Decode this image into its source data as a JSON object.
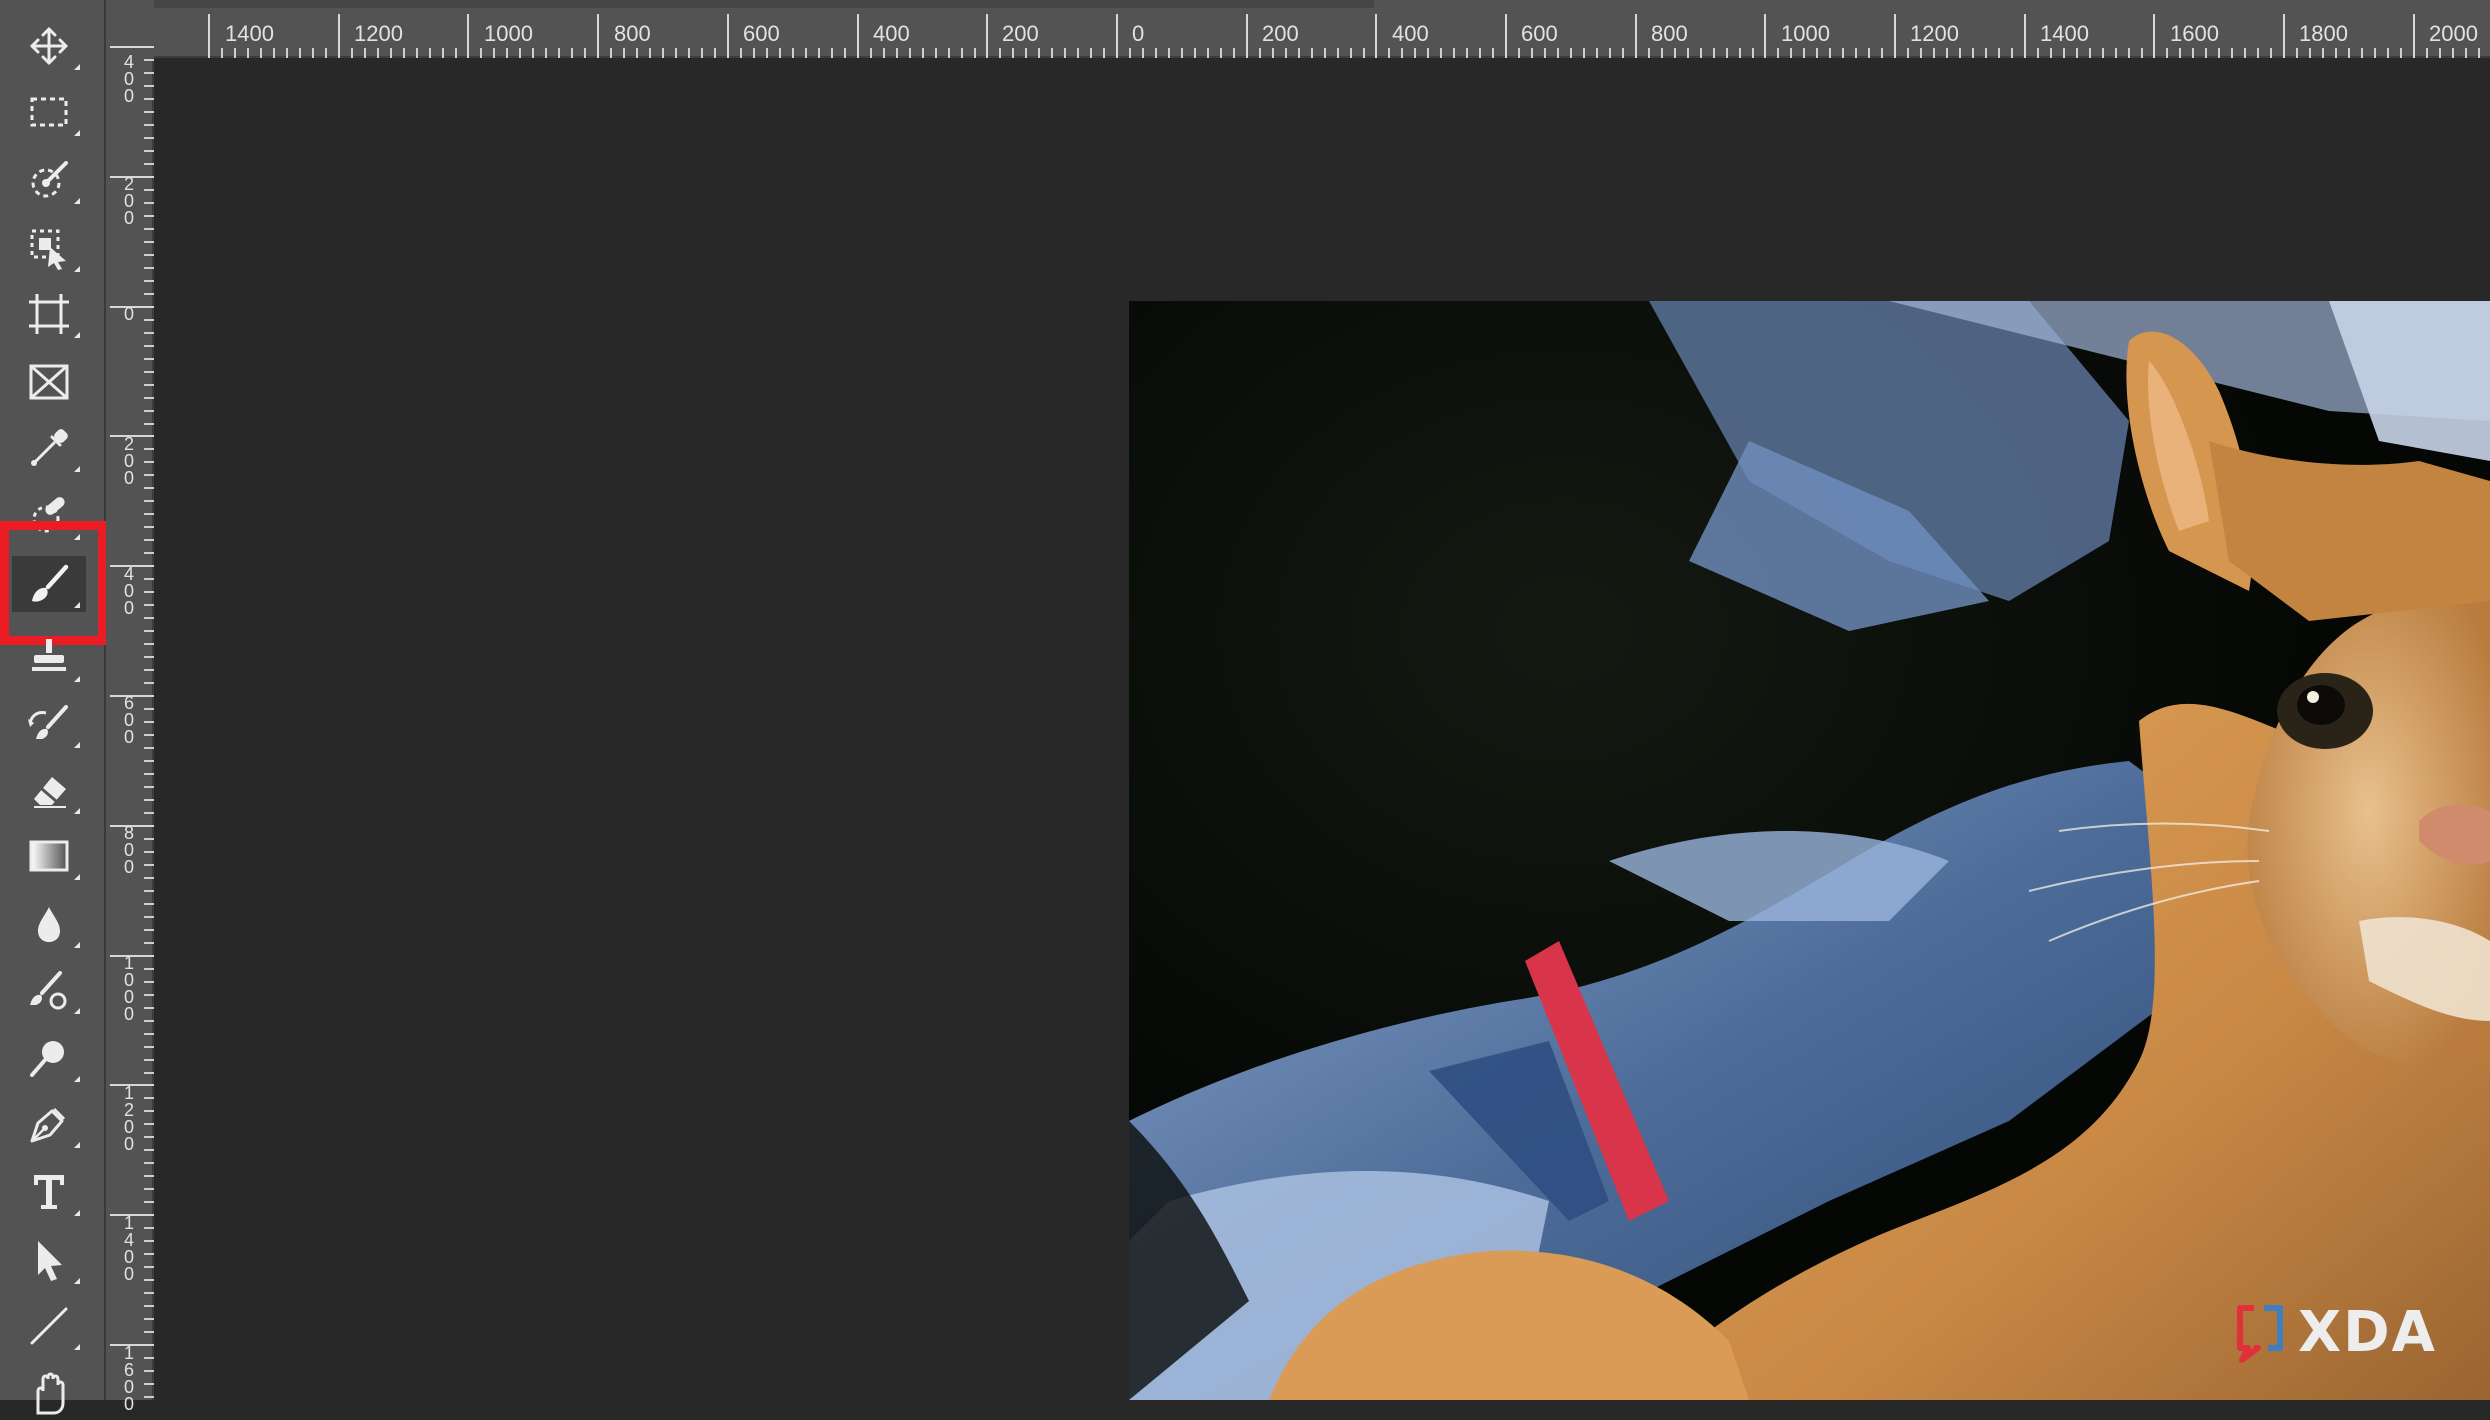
{
  "toolbar": {
    "tools": [
      {
        "name": "Move Tool",
        "icon": "move-icon"
      },
      {
        "name": "Rectangular Marquee Tool",
        "icon": "marquee-icon"
      },
      {
        "name": "Quick Selection Tool",
        "icon": "quick-selection-icon"
      },
      {
        "name": "Object Selection Tool",
        "icon": "object-selection-icon"
      },
      {
        "name": "Artboard Tool",
        "icon": "artboard-icon"
      },
      {
        "name": "Frame Tool",
        "icon": "frame-icon"
      },
      {
        "name": "Eyedropper Tool",
        "icon": "eyedropper-icon"
      },
      {
        "name": "Spot Healing Brush Tool",
        "icon": "healing-brush-icon"
      },
      {
        "name": "Brush Tool",
        "icon": "brush-icon",
        "selected": true,
        "highlighted": true
      },
      {
        "name": "Clone Stamp Tool",
        "icon": "clone-stamp-icon"
      },
      {
        "name": "History Brush Tool",
        "icon": "history-brush-icon"
      },
      {
        "name": "Eraser Tool",
        "icon": "eraser-icon"
      },
      {
        "name": "Gradient Tool",
        "icon": "gradient-icon"
      },
      {
        "name": "Blur Tool",
        "icon": "blur-icon"
      },
      {
        "name": "Mixer Brush Tool",
        "icon": "mixer-brush-icon"
      },
      {
        "name": "Dodge Tool",
        "icon": "dodge-icon"
      },
      {
        "name": "Pen Tool",
        "icon": "pen-icon"
      },
      {
        "name": "Type Tool",
        "icon": "type-icon"
      },
      {
        "name": "Path Selection Tool",
        "icon": "path-selection-icon"
      },
      {
        "name": "Line Tool",
        "icon": "line-icon"
      },
      {
        "name": "Hand Tool",
        "icon": "hand-icon"
      }
    ],
    "highlight_color": "#ec1c24"
  },
  "ruler_top": {
    "labels": [
      "1400",
      "1200",
      "1000",
      "800",
      "600",
      "400",
      "200",
      "0",
      "200",
      "400",
      "600",
      "800",
      "1000",
      "1200",
      "1400",
      "1600",
      "1800",
      "2000"
    ]
  },
  "ruler_left": {
    "labels": [
      "400",
      "200",
      "0",
      "200",
      "400",
      "600",
      "800",
      "1000",
      "1200",
      "1400",
      "1600"
    ]
  },
  "canvas": {
    "background": "#282828",
    "image_subject": "orange tabby cat lying on blue bedsheets"
  },
  "watermark": {
    "text": "XDA",
    "accent_color": "#e0303a"
  }
}
